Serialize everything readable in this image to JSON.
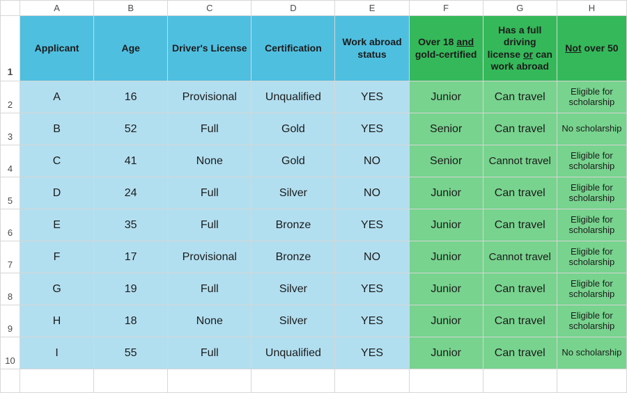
{
  "columns": [
    "A",
    "B",
    "C",
    "D",
    "E",
    "F",
    "G",
    "H"
  ],
  "rownums": [
    "1",
    "2",
    "3",
    "4",
    "5",
    "6",
    "7",
    "8",
    "9",
    "10"
  ],
  "headers": {
    "applicant": "Applicant",
    "age": "Age",
    "license": "Driver's License",
    "certification": "Certification",
    "work_abroad": "Work abroad status",
    "over18_pre": "Over 18 ",
    "over18_and": "and",
    "over18_post": " gold-certified",
    "hasfull_l1": "Has a full driving license ",
    "hasfull_or": "or",
    "hasfull_l2": " can work abroad",
    "notover_not": "Not",
    "notover_rest": " over 50"
  },
  "rows": [
    {
      "applicant": "A",
      "age": "16",
      "license": "Provisional",
      "cert": "Unqualified",
      "abroad": "YES",
      "f": "Junior",
      "g": "Can travel",
      "h": "Eligible for scholarship"
    },
    {
      "applicant": "B",
      "age": "52",
      "license": "Full",
      "cert": "Gold",
      "abroad": "YES",
      "f": "Senior",
      "g": "Can travel",
      "h": "No scholarship"
    },
    {
      "applicant": "C",
      "age": "41",
      "license": "None",
      "cert": "Gold",
      "abroad": "NO",
      "f": "Senior",
      "g": "Cannot travel",
      "h": "Eligible for scholarship"
    },
    {
      "applicant": "D",
      "age": "24",
      "license": "Full",
      "cert": "Silver",
      "abroad": "NO",
      "f": "Junior",
      "g": "Can travel",
      "h": "Eligible for scholarship"
    },
    {
      "applicant": "E",
      "age": "35",
      "license": "Full",
      "cert": "Bronze",
      "abroad": "YES",
      "f": "Junior",
      "g": "Can travel",
      "h": "Eligible for scholarship"
    },
    {
      "applicant": "F",
      "age": "17",
      "license": "Provisional",
      "cert": "Bronze",
      "abroad": "NO",
      "f": "Junior",
      "g": "Cannot travel",
      "h": "Eligible for scholarship"
    },
    {
      "applicant": "G",
      "age": "19",
      "license": "Full",
      "cert": "Silver",
      "abroad": "YES",
      "f": "Junior",
      "g": "Can travel",
      "h": "Eligible for scholarship"
    },
    {
      "applicant": "H",
      "age": "18",
      "license": "None",
      "cert": "Silver",
      "abroad": "YES",
      "f": "Junior",
      "g": "Can travel",
      "h": "Eligible for scholarship"
    },
    {
      "applicant": "I",
      "age": "55",
      "license": "Full",
      "cert": "Unqualified",
      "abroad": "YES",
      "f": "Junior",
      "g": "Can travel",
      "h": "No scholarship"
    }
  ],
  "chart_data": {
    "type": "table",
    "columns": [
      "Applicant",
      "Age",
      "Driver's License",
      "Certification",
      "Work abroad status",
      "Over 18 and gold-certified",
      "Has a full driving license or can work abroad",
      "Not over 50"
    ],
    "rows": [
      [
        "A",
        16,
        "Provisional",
        "Unqualified",
        "YES",
        "Junior",
        "Can travel",
        "Eligible for scholarship"
      ],
      [
        "B",
        52,
        "Full",
        "Gold",
        "YES",
        "Senior",
        "Can travel",
        "No scholarship"
      ],
      [
        "C",
        41,
        "None",
        "Gold",
        "NO",
        "Senior",
        "Cannot travel",
        "Eligible for scholarship"
      ],
      [
        "D",
        24,
        "Full",
        "Silver",
        "NO",
        "Junior",
        "Can travel",
        "Eligible for scholarship"
      ],
      [
        "E",
        35,
        "Full",
        "Bronze",
        "YES",
        "Junior",
        "Can travel",
        "Eligible for scholarship"
      ],
      [
        "F",
        17,
        "Provisional",
        "Bronze",
        "NO",
        "Junior",
        "Cannot travel",
        "Eligible for scholarship"
      ],
      [
        "G",
        19,
        "Full",
        "Silver",
        "YES",
        "Junior",
        "Can travel",
        "Eligible for scholarship"
      ],
      [
        "H",
        18,
        "None",
        "Silver",
        "YES",
        "Junior",
        "Can travel",
        "Eligible for scholarship"
      ],
      [
        "I",
        55,
        "Full",
        "Unqualified",
        "YES",
        "Junior",
        "Can travel",
        "No scholarship"
      ]
    ]
  }
}
